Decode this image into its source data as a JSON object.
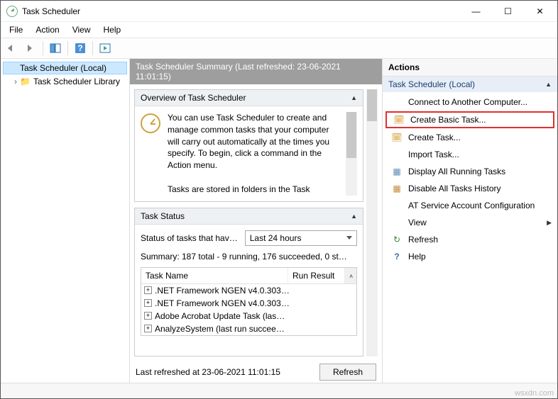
{
  "title": "Task Scheduler",
  "window_controls": {
    "min": "—",
    "max": "☐",
    "close": "✕"
  },
  "menu": [
    "File",
    "Action",
    "View",
    "Help"
  ],
  "tree": {
    "root": "Task Scheduler (Local)",
    "child": "Task Scheduler Library",
    "collapse_glyph": "˅",
    "expand_glyph": "›"
  },
  "center": {
    "header": "Task Scheduler Summary (Last refreshed: 23-06-2021 11:01:15)",
    "overview": {
      "title": "Overview of Task Scheduler",
      "text": "You can use Task Scheduler to create and manage common tasks that your computer will carry out automatically at the times you specify. To begin, click a command in the Action menu.",
      "more": "Tasks are stored in folders in the Task"
    },
    "status": {
      "title": "Task Status",
      "label": "Status of tasks that hav…",
      "dropdown": "Last 24 hours",
      "summary": "Summary: 187 total - 9 running, 176 succeeded, 0 st…",
      "cols": {
        "c1": "Task Name",
        "c2": "Run Result"
      },
      "rows": [
        ".NET Framework NGEN v4.0.303…",
        ".NET Framework NGEN v4.0.303…",
        "Adobe Acrobat Update Task (las…",
        "AnalyzeSystem (last run succee…"
      ]
    },
    "footer": "Last refreshed at 23-06-2021 11:01:15",
    "refresh_btn": "Refresh"
  },
  "actions": {
    "header": "Actions",
    "group": "Task Scheduler (Local)",
    "items": [
      {
        "icon": "",
        "label": "Connect to Another Computer..."
      },
      {
        "icon": "🗓",
        "label": "Create Basic Task...",
        "highlight": true
      },
      {
        "icon": "🗓",
        "label": "Create Task..."
      },
      {
        "icon": "",
        "label": "Import Task..."
      },
      {
        "icon": "▦",
        "label": "Display All Running Tasks"
      },
      {
        "icon": "▦",
        "label": "Disable All Tasks History"
      },
      {
        "icon": "",
        "label": "AT Service Account Configuration"
      },
      {
        "icon": "",
        "label": "View",
        "arrow": true
      },
      {
        "icon": "↻",
        "label": "Refresh"
      },
      {
        "icon": "?",
        "label": "Help"
      }
    ]
  },
  "watermark": "wsxdn.com"
}
